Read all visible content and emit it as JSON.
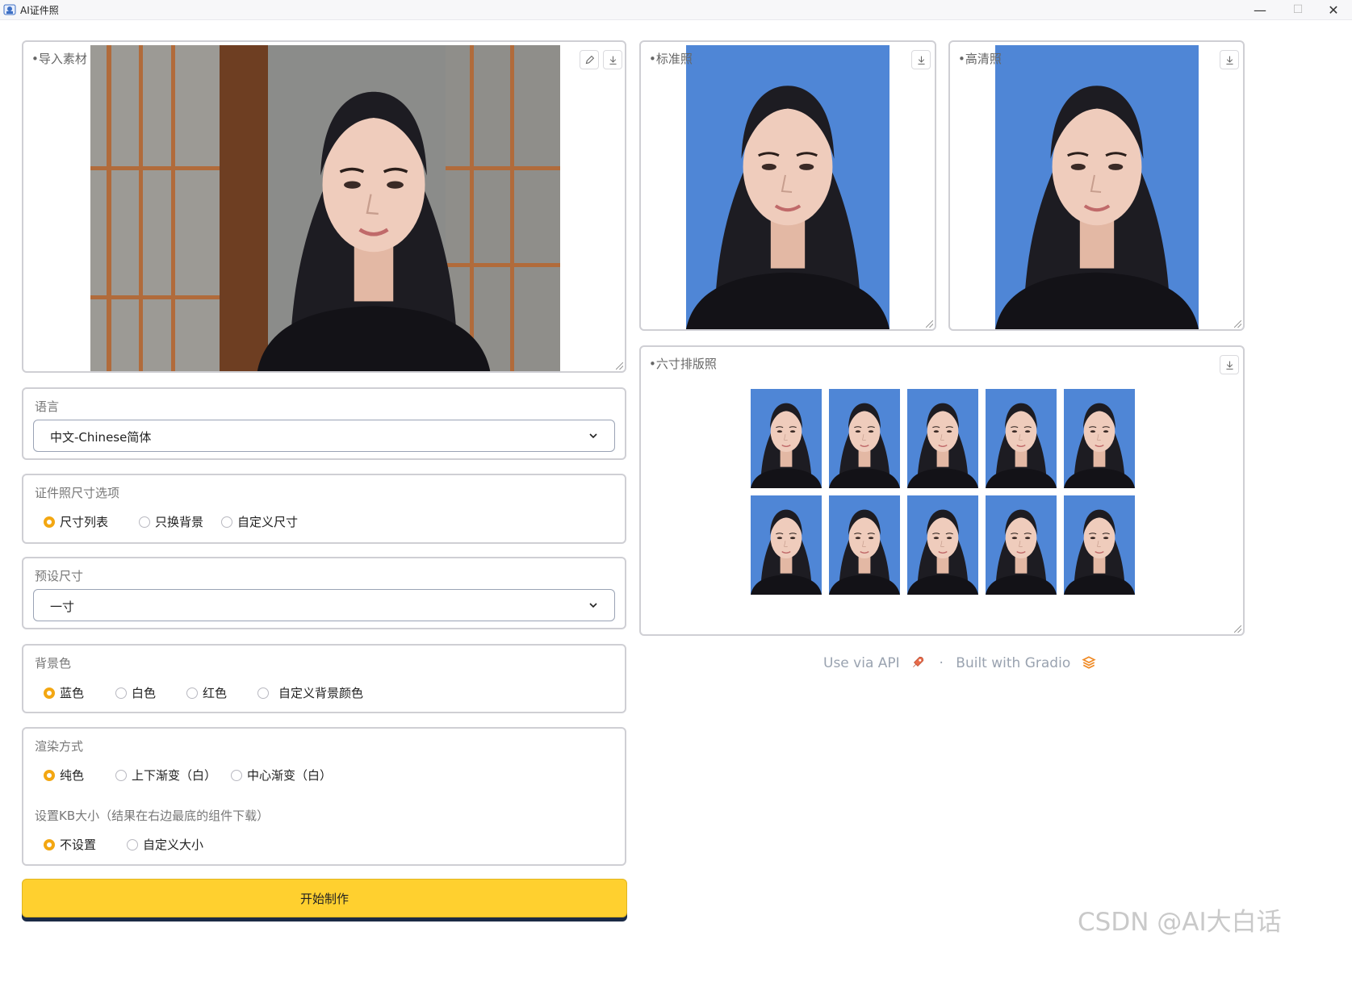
{
  "window": {
    "title": "AI证件照",
    "minimize_symbol": "—",
    "maximize_symbol": "☐",
    "close_symbol": "✕"
  },
  "input_panel": {
    "label": "•导入素材",
    "edit_icon": "pencil-icon",
    "download_icon": "download-icon"
  },
  "standard_panel": {
    "label": "•标准照",
    "download_icon": "download-icon"
  },
  "hd_panel": {
    "label": "•高清照",
    "download_icon": "download-icon"
  },
  "layout_panel": {
    "label": "•六寸排版照",
    "download_icon": "download-icon",
    "grid_rows": 2,
    "grid_cols": 5
  },
  "language": {
    "label": "语言",
    "value": "中文-Chinese简体"
  },
  "size_option": {
    "label": "证件照尺寸选项",
    "options": [
      "尺寸列表",
      "只换背景",
      "自定义尺寸"
    ],
    "selected": "尺寸列表"
  },
  "preset_size": {
    "label": "预设尺寸",
    "value": "一寸"
  },
  "background_color": {
    "label": "背景色",
    "options": [
      "蓝色",
      "白色",
      "红色",
      "自定义背景颜色"
    ],
    "selected": "蓝色"
  },
  "render_mode": {
    "label": "渲染方式",
    "options": [
      "纯色",
      "上下渐变（白）",
      "中心渐变（白）"
    ],
    "selected": "纯色"
  },
  "kb_size": {
    "label": "设置KB大小（结果在右边最底的组件下载）",
    "options": [
      "不设置",
      "自定义大小"
    ],
    "selected": "不设置"
  },
  "start_button": {
    "label": "开始制作"
  },
  "footer": {
    "api_text": "Use via API",
    "separator": "·",
    "built_text": "Built with Gradio"
  },
  "watermark": "CSDN @AI大白话",
  "colors": {
    "accent": "#f3a712",
    "button": "#ffd02f",
    "photo_bg": "#4f86d6",
    "border": "#cfcfd4"
  }
}
